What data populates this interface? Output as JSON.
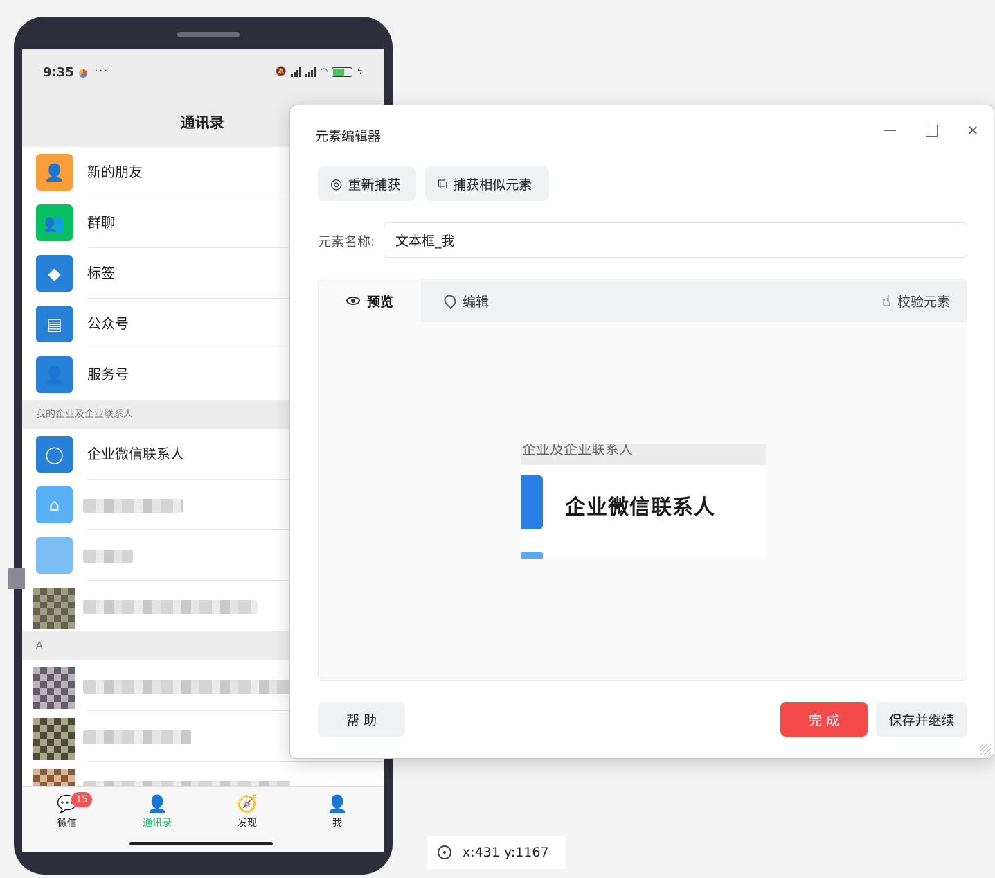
{
  "phone": {
    "status": {
      "time": "9:35",
      "more": "···",
      "battery": "56"
    },
    "header": {
      "title": "通讯录"
    },
    "top_items": [
      {
        "label": "新的朋友",
        "icon": "add-friend-icon",
        "color": "#fa9d3b"
      },
      {
        "label": "群聊",
        "icon": "group-chat-icon",
        "color": "#07c160"
      },
      {
        "label": "标签",
        "icon": "tag-icon",
        "color": "#2782d7"
      },
      {
        "label": "公众号",
        "icon": "official-account-icon",
        "color": "#2782d7"
      },
      {
        "label": "服务号",
        "icon": "service-account-icon",
        "color": "#2782d7"
      }
    ],
    "section_enterprise": "我的企业及企业联系人",
    "enterprise_item": {
      "label": "企业微信联系人",
      "icon": "wecom-contacts-icon",
      "color": "#2782d7"
    },
    "section_a": "A",
    "tabs": [
      {
        "label": "微信",
        "icon": "chat-bubble-icon",
        "badge": "15"
      },
      {
        "label": "通讯录",
        "icon": "contacts-icon",
        "active": true
      },
      {
        "label": "发现",
        "icon": "compass-icon"
      },
      {
        "label": "我",
        "icon": "person-icon"
      }
    ]
  },
  "dialog": {
    "title": "元素编辑器",
    "toolbar": {
      "recapture": "重新捕获",
      "capture_similar": "捕获相似元素"
    },
    "name_label": "元素名称:",
    "name_value": "文本框_我",
    "tabs": {
      "preview": "预览",
      "edit": "编辑",
      "verify": "校验元素"
    },
    "preview": {
      "header_text": "企业及企业联系人",
      "text": "企业微信联系人"
    },
    "buttons": {
      "help": "帮 助",
      "done": "完 成",
      "save_continue": "保存并继续"
    },
    "accent": "#f54a4a"
  },
  "coords": {
    "text": "x:431 y:1167"
  }
}
